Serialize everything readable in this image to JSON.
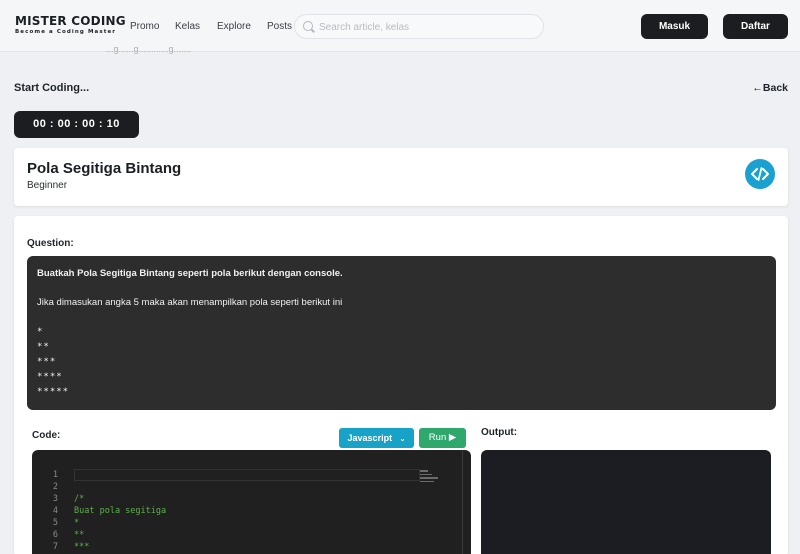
{
  "header": {
    "logo_title": "MISTER CODING",
    "logo_subtitle": "Become a Coding Master",
    "nav": [
      "Promo",
      "Kelas",
      "Explore",
      "Posts"
    ],
    "search_placeholder": "Search article, kelas",
    "login_label": "Masuk",
    "register_label": "Daftar"
  },
  "page": {
    "ghost_text": "...g......g............g.......",
    "title": "Start Coding...",
    "back_label": "Back",
    "timer": "00 : 00 : 00 : 10"
  },
  "challenge": {
    "title": "Pola Segitiga Bintang",
    "level": "Beginner",
    "icon": "code-icon"
  },
  "question": {
    "label": "Question:",
    "heading": "Buatkah Pola Segitiga Bintang seperti pola berikut dengan console.",
    "description": "Jika dimasukan angka 5 maka akan menampilkan pola seperti berikut ini",
    "pattern": [
      "*",
      "**",
      "***",
      "****",
      "*****"
    ]
  },
  "editor": {
    "code_label": "Code:",
    "language": "Javascript",
    "run_label": "Run",
    "output_label": "Output:",
    "line_numbers": [
      "1",
      "2",
      "3",
      "4",
      "5",
      "6",
      "7"
    ],
    "lines": [
      "",
      "",
      "/*",
      "Buat pola segitiga",
      "*",
      "**",
      "***"
    ]
  },
  "colors": {
    "accent_blue": "#17a2c8",
    "run_green": "#2fa86e",
    "dark": "#1b1d20"
  }
}
